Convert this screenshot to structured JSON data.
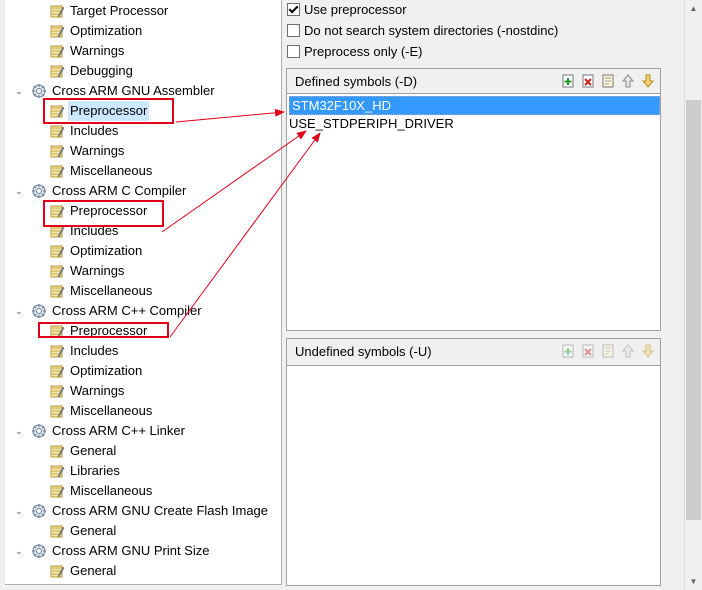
{
  "tree": {
    "items": [
      {
        "label": "Target Processor",
        "level": 1,
        "icon": "properties-icon"
      },
      {
        "label": "Optimization",
        "level": 1,
        "icon": "properties-icon"
      },
      {
        "label": "Warnings",
        "level": 1,
        "icon": "properties-icon"
      },
      {
        "label": "Debugging",
        "level": 1,
        "icon": "properties-icon"
      },
      {
        "label": "Cross ARM GNU Assembler",
        "level": 0,
        "icon": "tool-gear-icon",
        "expanded": true
      },
      {
        "label": "Preprocessor",
        "level": 1,
        "icon": "properties-icon",
        "selected": true
      },
      {
        "label": "Includes",
        "level": 1,
        "icon": "properties-icon"
      },
      {
        "label": "Warnings",
        "level": 1,
        "icon": "properties-icon"
      },
      {
        "label": "Miscellaneous",
        "level": 1,
        "icon": "properties-icon"
      },
      {
        "label": "Cross ARM C Compiler",
        "level": 0,
        "icon": "tool-gear-icon",
        "expanded": true
      },
      {
        "label": "Preprocessor",
        "level": 1,
        "icon": "properties-icon"
      },
      {
        "label": "Includes",
        "level": 1,
        "icon": "properties-icon"
      },
      {
        "label": "Optimization",
        "level": 1,
        "icon": "properties-icon"
      },
      {
        "label": "Warnings",
        "level": 1,
        "icon": "properties-icon"
      },
      {
        "label": "Miscellaneous",
        "level": 1,
        "icon": "properties-icon"
      },
      {
        "label": "Cross ARM C++ Compiler",
        "level": 0,
        "icon": "tool-gear-icon",
        "expanded": true
      },
      {
        "label": "Preprocessor",
        "level": 1,
        "icon": "properties-icon"
      },
      {
        "label": "Includes",
        "level": 1,
        "icon": "properties-icon"
      },
      {
        "label": "Optimization",
        "level": 1,
        "icon": "properties-icon"
      },
      {
        "label": "Warnings",
        "level": 1,
        "icon": "properties-icon"
      },
      {
        "label": "Miscellaneous",
        "level": 1,
        "icon": "properties-icon"
      },
      {
        "label": "Cross ARM C++ Linker",
        "level": 0,
        "icon": "tool-gear-icon",
        "expanded": true
      },
      {
        "label": "General",
        "level": 1,
        "icon": "properties-icon"
      },
      {
        "label": "Libraries",
        "level": 1,
        "icon": "properties-icon"
      },
      {
        "label": "Miscellaneous",
        "level": 1,
        "icon": "properties-icon"
      },
      {
        "label": "Cross ARM GNU Create Flash Image",
        "level": 0,
        "icon": "tool-gear-icon",
        "expanded": true
      },
      {
        "label": "General",
        "level": 1,
        "icon": "properties-icon"
      },
      {
        "label": "Cross ARM GNU Print Size",
        "level": 0,
        "icon": "tool-gear-icon",
        "expanded": true
      },
      {
        "label": "General",
        "level": 1,
        "icon": "properties-icon"
      }
    ]
  },
  "options": {
    "use_preprocessor": {
      "label": "Use preprocessor",
      "checked": true
    },
    "nostdinc": {
      "label": "Do not search system directories (-nostdinc)",
      "checked": false
    },
    "preprocess_only": {
      "label": "Preprocess only (-E)",
      "checked": false
    }
  },
  "defined_symbols": {
    "title": "Defined symbols (-D)",
    "items": [
      {
        "value": "STM32F10X_HD",
        "selected": true
      },
      {
        "value": "USE_STDPERIPH_DRIVER",
        "selected": false
      }
    ]
  },
  "undefined_symbols": {
    "title": "Undefined symbols (-U)",
    "items": []
  },
  "toolbar_icons": [
    "add-icon",
    "delete-icon",
    "edit-icon",
    "move-up-icon",
    "move-down-icon"
  ],
  "colors": {
    "annotation_red": "#e0001b",
    "selection_blue": "#3399ff",
    "tree_selection": "#cce8ff"
  }
}
